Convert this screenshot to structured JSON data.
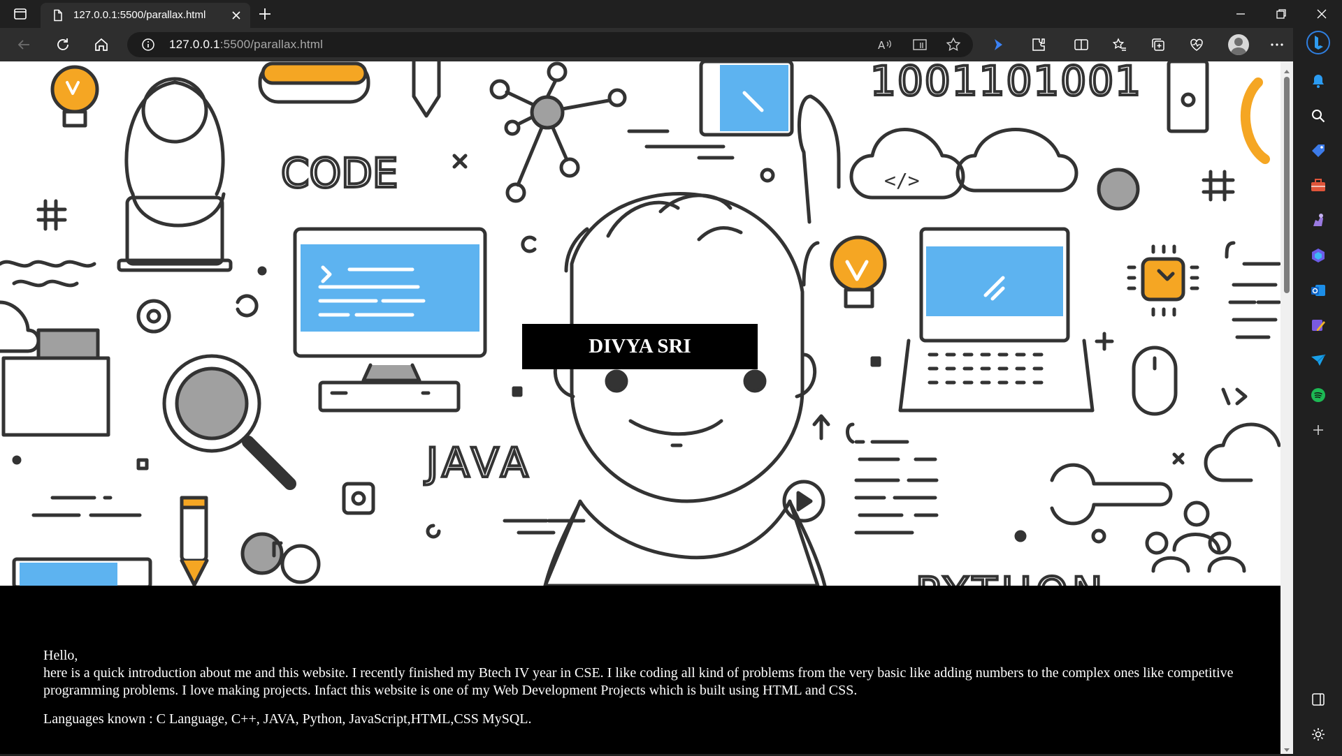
{
  "browser": {
    "tab_title": "127.0.0.1:5500/parallax.html",
    "url_host": "127.0.0.1",
    "url_rest": ":5500/parallax.html"
  },
  "page": {
    "hero_title": "DIVYA SRI",
    "hero_doodle_words": {
      "code": "CODE",
      "java": "JAVA",
      "python": "PYTHON",
      "binary": "1001101001"
    },
    "intro_greeting": "Hello,",
    "intro_paragraph": "here is a quick introduction about me and this website. I recently finished my Btech IV year in CSE. I like coding all kind of problems from the very basic like adding numbers to the complex ones like competitive programming problems. I love making projects. Infact this website is one of my Web Development Projects which is built using HTML and CSS.",
    "languages_line": "Languages known : C Language, C++, JAVA, Python, JavaScript,HTML,CSS MySQL."
  },
  "colors": {
    "hero_accent_blue": "#5db3f0",
    "hero_accent_orange": "#f5a623",
    "hero_gray": "#a0a0a0",
    "line_color": "#333333"
  }
}
